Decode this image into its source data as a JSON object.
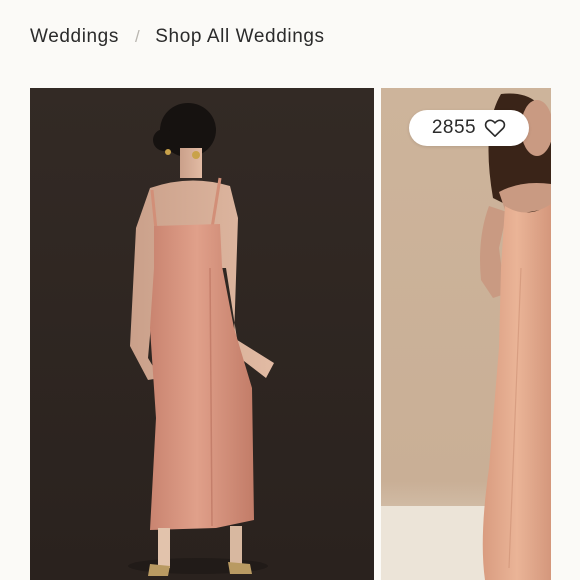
{
  "breadcrumb": {
    "items": [
      {
        "label": "Weddings"
      },
      {
        "label": "Shop All Weddings"
      }
    ],
    "separator": "/"
  },
  "products": [
    {
      "image": "model-back-view-dress-image",
      "dress_color": "#d7937b"
    },
    {
      "image": "model-front-view-dress-image",
      "dress_color": "#e0a689",
      "likes": "2855",
      "like_icon": "heart-outline-icon"
    }
  ],
  "colors": {
    "page_background": "#fbfaf7",
    "photo_1_backdrop": "#2f2723",
    "photo_2_backdrop": "#cbb39a"
  }
}
